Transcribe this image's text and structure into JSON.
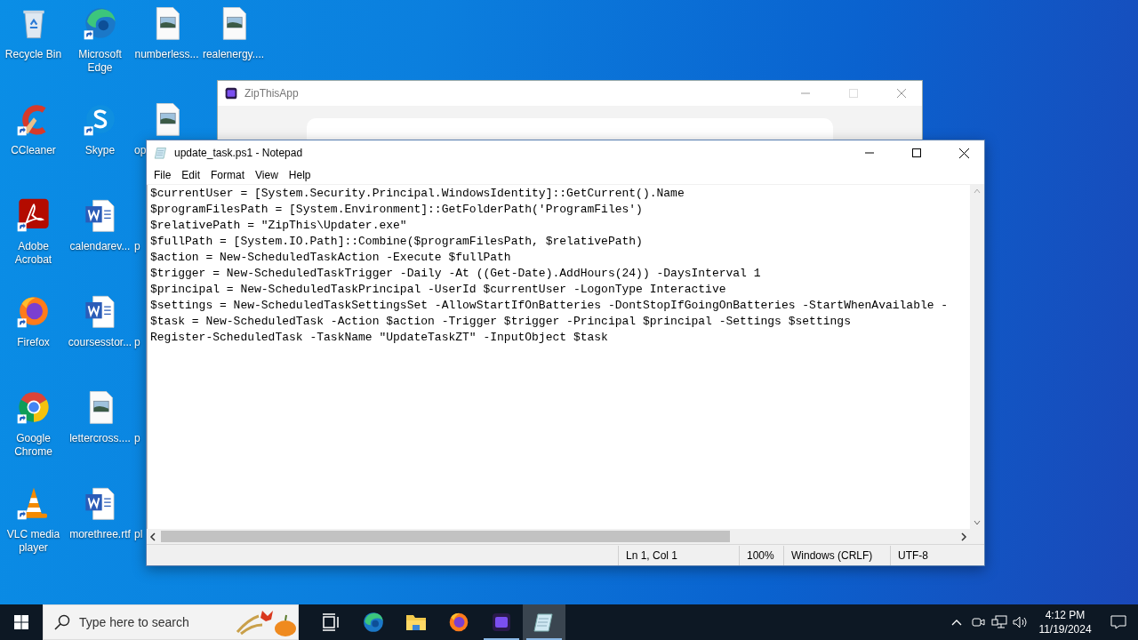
{
  "desktop_icons": [
    {
      "label": "Recycle Bin",
      "kind": "recycle",
      "shortcut": false,
      "partial": false
    },
    {
      "label": "CCleaner",
      "kind": "ccleaner",
      "shortcut": true,
      "partial": false
    },
    {
      "label": "Adobe Acrobat",
      "kind": "pdf",
      "shortcut": true,
      "partial": false
    },
    {
      "label": "Firefox",
      "kind": "firefox",
      "shortcut": true,
      "partial": false
    },
    {
      "label": "Google Chrome",
      "kind": "chrome",
      "shortcut": true,
      "partial": false
    },
    {
      "label": "VLC media player",
      "kind": "vlc",
      "shortcut": true,
      "partial": false
    },
    {
      "label": "Microsoft Edge",
      "kind": "edge",
      "shortcut": true,
      "partial": false
    },
    {
      "label": "Skype",
      "kind": "skype",
      "shortcut": true,
      "partial": false
    },
    {
      "label": "calendarev...",
      "kind": "word",
      "shortcut": false,
      "partial": false
    },
    {
      "label": "coursesstor...",
      "kind": "word",
      "shortcut": false,
      "partial": false
    },
    {
      "label": "lettercross....",
      "kind": "image",
      "shortcut": false,
      "partial": false
    },
    {
      "label": "morethree.rtf",
      "kind": "word",
      "shortcut": false,
      "partial": false
    },
    {
      "label": "numberless...",
      "kind": "image",
      "shortcut": false,
      "partial": false
    },
    {
      "label": "op",
      "kind": "image",
      "shortcut": false,
      "partial": true
    },
    {
      "label": "p",
      "partial": true
    },
    {
      "label": "p",
      "partial": true
    },
    {
      "label": "p",
      "partial": true
    },
    {
      "label": "pl",
      "partial": true
    },
    {
      "label": "realenergy....",
      "kind": "image",
      "shortcut": false,
      "partial": false
    }
  ],
  "background_window": {
    "title": "ZipThisApp"
  },
  "notepad": {
    "title": "update_task.ps1 - Notepad",
    "menu": [
      "File",
      "Edit",
      "Format",
      "View",
      "Help"
    ],
    "lines": [
      "$currentUser = [System.Security.Principal.WindowsIdentity]::GetCurrent().Name",
      "$programFilesPath = [System.Environment]::GetFolderPath('ProgramFiles')",
      "$relativePath = \"ZipThis\\Updater.exe\"",
      "$fullPath = [System.IO.Path]::Combine($programFilesPath, $relativePath)",
      "$action = New-ScheduledTaskAction -Execute $fullPath",
      "$trigger = New-ScheduledTaskTrigger -Daily -At ((Get-Date).AddHours(24)) -DaysInterval 1",
      "$principal = New-ScheduledTaskPrincipal -UserId $currentUser -LogonType Interactive",
      "$settings = New-ScheduledTaskSettingsSet -AllowStartIfOnBatteries -DontStopIfGoingOnBatteries -StartWhenAvailable -",
      "$task = New-ScheduledTask -Action $action -Trigger $trigger -Principal $principal -Settings $settings",
      "Register-ScheduledTask -TaskName \"UpdateTaskZT\" -InputObject $task"
    ],
    "status": [
      "Ln 1, Col 1",
      "100%",
      "Windows (CRLF)",
      "UTF-8"
    ]
  },
  "taskbar": {
    "search_placeholder": "Type here to search",
    "apps": [
      {
        "kind": "taskview",
        "running": false,
        "selected": false
      },
      {
        "kind": "edge",
        "running": false,
        "selected": false
      },
      {
        "kind": "explorer",
        "running": false,
        "selected": false
      },
      {
        "kind": "firefox",
        "running": false,
        "selected": false
      },
      {
        "kind": "zipthis",
        "running": true,
        "selected": false
      },
      {
        "kind": "notepad",
        "running": true,
        "selected": true
      }
    ],
    "time": "4:12 PM",
    "date": "11/19/2024"
  }
}
